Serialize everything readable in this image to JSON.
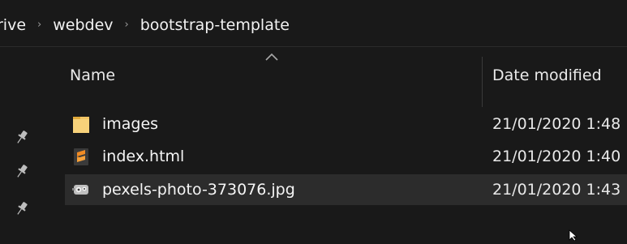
{
  "breadcrumb": {
    "items": [
      "rive",
      "webdev",
      "bootstrap-template"
    ],
    "separator": "›"
  },
  "columns": {
    "name": "Name",
    "date_modified": "Date modified"
  },
  "files": [
    {
      "name": "images",
      "date": "21/01/2020 1:48",
      "icon": "folder-icon"
    },
    {
      "name": "index.html",
      "date": "21/01/2020 1:40",
      "icon": "sublime-text-file-icon"
    },
    {
      "name": "pexels-photo-373076.jpg",
      "date": "21/01/2020 1:43",
      "icon": "image-file-icon",
      "selected": true
    }
  ],
  "quick_access_pins": 3,
  "colors": {
    "background": "#191919",
    "selected_row": "#2c2c2c",
    "folder": "#f2c464",
    "sublime": "#f08b24"
  }
}
